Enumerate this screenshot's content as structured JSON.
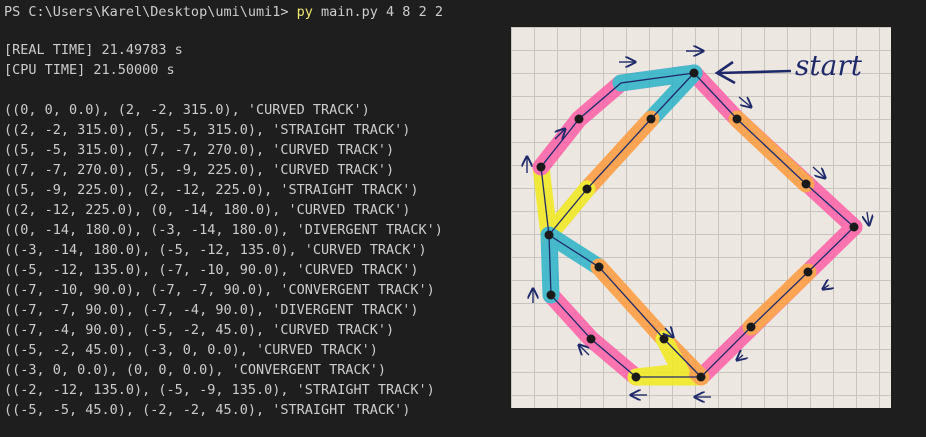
{
  "terminal": {
    "prompt": "PS C:\\Users\\Karel\\Desktop\\umi\\umi1>",
    "command_name": "py",
    "command_args": "main.py 4 8 2 2",
    "real_time": "[REAL TIME] 21.49783 s",
    "cpu_time": "[CPU TIME] 21.50000 s",
    "lines": [
      "((0, 0, 0.0), (2, -2, 315.0), 'CURVED TRACK')",
      "((2, -2, 315.0), (5, -5, 315.0), 'STRAIGHT TRACK')",
      "((5, -5, 315.0), (7, -7, 270.0), 'CURVED TRACK')",
      "((7, -7, 270.0), (5, -9, 225.0), 'CURVED TRACK')",
      "((5, -9, 225.0), (2, -12, 225.0), 'STRAIGHT TRACK')",
      "((2, -12, 225.0), (0, -14, 180.0), 'CURVED TRACK')",
      "((0, -14, 180.0), (-3, -14, 180.0), 'DIVERGENT TRACK')",
      "((-3, -14, 180.0), (-5, -12, 135.0), 'CURVED TRACK')",
      "((-5, -12, 135.0), (-7, -10, 90.0), 'CURVED TRACK')",
      "((-7, -10, 90.0), (-7, -7, 90.0), 'CONVERGENT TRACK')",
      "((-7, -7, 90.0), (-7, -4, 90.0), 'DIVERGENT TRACK')",
      "((-7, -4, 90.0), (-5, -2, 45.0), 'CURVED TRACK')",
      "((-5, -2, 45.0), (-3, 0, 0.0), 'CURVED TRACK')",
      "((-3, 0, 0.0), (0, 0, 0.0), 'CONVERGENT TRACK')",
      "((-2, -12, 135.0), (-5, -9, 135.0), 'STRAIGHT TRACK')",
      "((-5, -5, 45.0), (-2, -2, 45.0), 'STRAIGHT TRACK')"
    ]
  },
  "photo": {
    "annotation": "start",
    "colors": {
      "pink": "#ff5fa8",
      "orange": "#ff9a3c",
      "yellow": "#f2ea1c",
      "cyan": "#2bb2c9",
      "ink": "#1f2a6b"
    }
  }
}
